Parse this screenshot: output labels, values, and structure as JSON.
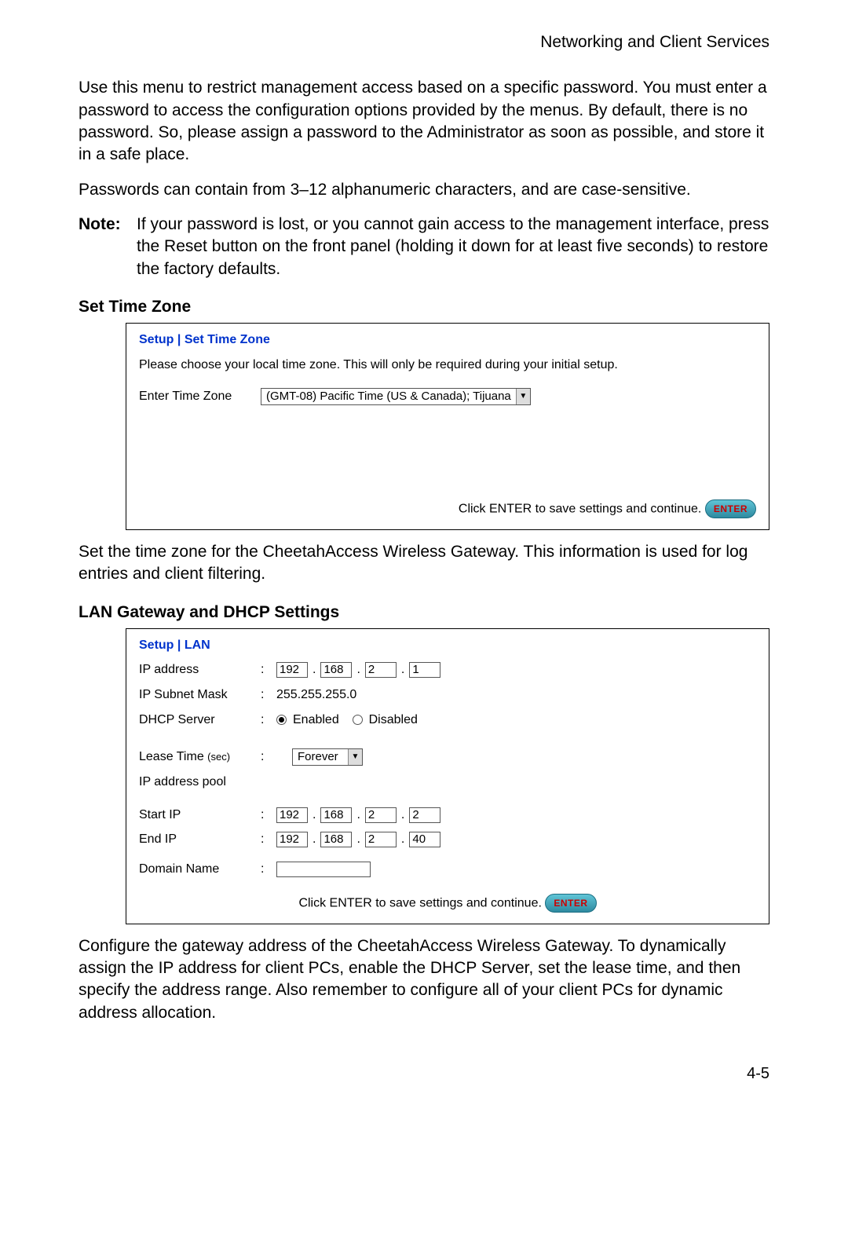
{
  "header": {
    "title": "Networking and Client Services"
  },
  "intro": {
    "p1": "Use this menu to restrict management access based on a specific password. You must enter a password to access the configuration options provided by the menus. By default, there is no password. So, please assign a password to the Administrator as soon as possible, and store it in a safe place.",
    "p2": "Passwords can contain from 3–12 alphanumeric characters, and are case-sensitive.",
    "note_label": "Note:",
    "note_body": "If your password is lost, or you cannot gain access to the management interface, press the Reset button on the front panel (holding it down for at least five seconds) to restore the factory defaults."
  },
  "tz": {
    "heading": "Set Time Zone",
    "breadcrumb": "Setup | Set Time Zone",
    "instr": "Please choose your local time zone. This will only be required during your initial setup.",
    "label": "Enter Time Zone",
    "selected": "(GMT-08) Pacific Time (US & Canada); Tijuana",
    "save_text": "Click ENTER to save settings and continue.",
    "enter": "ENTER",
    "after": "Set the time zone for the CheetahAccess Wireless Gateway. This information is used for log entries and client filtering."
  },
  "lan": {
    "heading": "LAN Gateway and DHCP Settings",
    "breadcrumb": "Setup | LAN",
    "ip_label": "IP address",
    "ip": {
      "a": "192",
      "b": "168",
      "c": "2",
      "d": "1"
    },
    "subnet_label": "IP Subnet Mask",
    "subnet": "255.255.255.0",
    "dhcp_label": "DHCP Server",
    "dhcp_enabled": "Enabled",
    "dhcp_disabled": "Disabled",
    "lease_label": "Lease Time",
    "lease_unit": "(sec)",
    "lease_selected": "Forever",
    "pool_label": "IP address pool",
    "start_label": "Start IP",
    "start": {
      "a": "192",
      "b": "168",
      "c": "2",
      "d": "2"
    },
    "end_label": "End IP",
    "end": {
      "a": "192",
      "b": "168",
      "c": "2",
      "d": "40"
    },
    "domain_label": "Domain Name",
    "save_text": "Click ENTER to save settings and continue.",
    "enter": "ENTER",
    "after": "Configure the gateway address of the CheetahAccess Wireless Gateway. To dynamically assign the IP address for client PCs, enable the DHCP Server, set the lease time, and then specify the address range. Also remember to configure all of your client PCs for dynamic address allocation."
  },
  "page_number": "4-5"
}
